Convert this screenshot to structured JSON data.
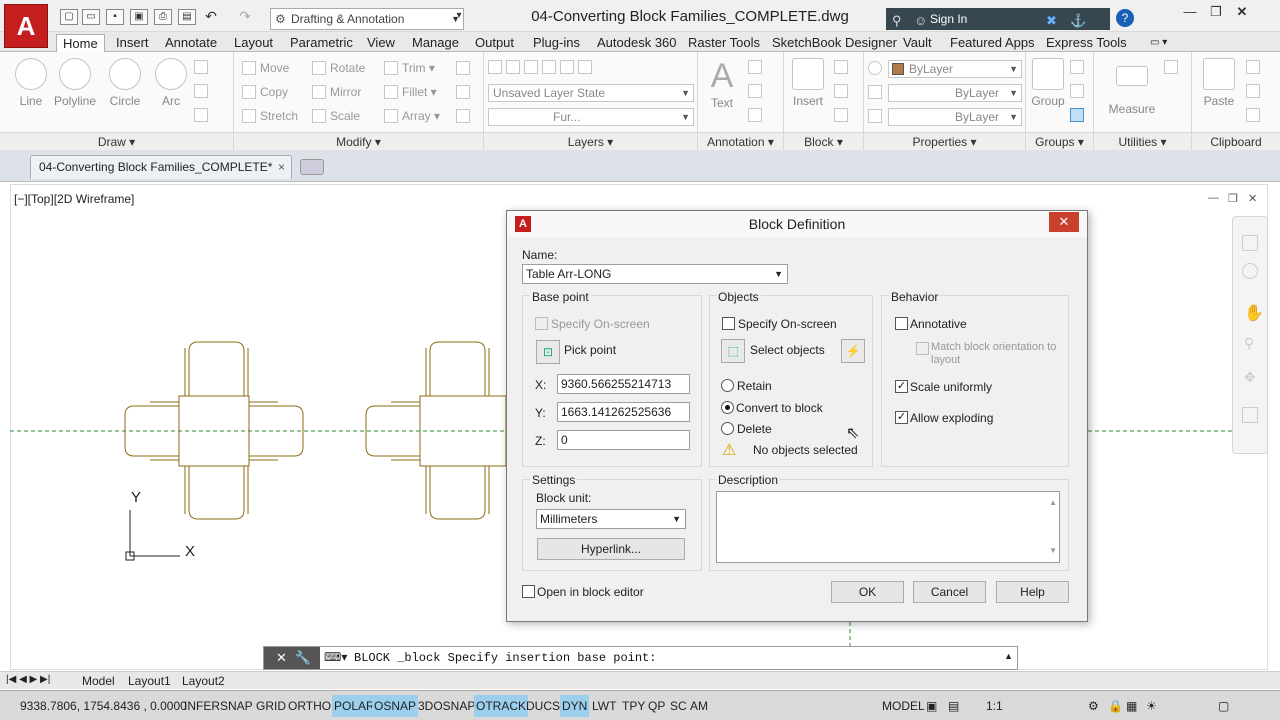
{
  "app": {
    "logo_letter": "A",
    "workspace": "Drafting & Annotation",
    "document_title": "04-Converting Block Families_COMPLETE.dwg",
    "signin": "Sign In"
  },
  "ribbon": {
    "tabs": [
      "Home",
      "Insert",
      "Annotate",
      "Layout",
      "Parametric",
      "View",
      "Manage",
      "Output",
      "Plug-ins",
      "Autodesk 360",
      "Raster Tools",
      "SketchBook Designer",
      "Vault",
      "Featured Apps",
      "Express Tools"
    ],
    "draw": {
      "line": "Line",
      "polyline": "Polyline",
      "circle": "Circle",
      "arc": "Arc",
      "title": "Draw"
    },
    "modify": {
      "move": "Move",
      "rotate": "Rotate",
      "trim": "Trim",
      "copy": "Copy",
      "mirror": "Mirror",
      "fillet": "Fillet",
      "stretch": "Stretch",
      "scale": "Scale",
      "array": "Array",
      "title": "Modify"
    },
    "layers": {
      "state": "Unsaved Layer State",
      "current": "Fur...",
      "title": "Layers"
    },
    "annotation": {
      "text": "Text",
      "title": "Annotation"
    },
    "block": {
      "insert": "Insert",
      "title": "Block"
    },
    "properties": {
      "color": "ByLayer",
      "linetype": "ByLayer",
      "lineweight": "ByLayer",
      "title": "Properties",
      "swatch": "#b07a4a"
    },
    "groups": {
      "group": "Group",
      "title": "Groups"
    },
    "utilities": {
      "measure": "Measure",
      "title": "Utilities"
    },
    "clipboard": {
      "paste": "Paste",
      "title": "Clipboard"
    }
  },
  "doc_tab": {
    "label": "04-Converting Block Families_COMPLETE*",
    "close": "×"
  },
  "viewport": {
    "label": "[−][Top][2D Wireframe]",
    "ucs_y": "Y",
    "ucs_x": "X",
    "furniture_color": "#8b6d14",
    "centerline_color": "#2e8b2e"
  },
  "dialog": {
    "title": "Block Definition",
    "close": "✕",
    "name_label": "Name:",
    "name_value": "Table Arr-LONG",
    "base_point": {
      "title": "Base point",
      "specify": "Specify On-screen",
      "pick": "Pick point",
      "x_label": "X:",
      "x": "9360.566255214713",
      "y_label": "Y:",
      "y": "1663.141262525636",
      "z_label": "Z:",
      "z": "0"
    },
    "objects": {
      "title": "Objects",
      "specify": "Specify On-screen",
      "select": "Select objects",
      "retain": "Retain",
      "convert": "Convert to block",
      "delete": "Delete",
      "warning": "No objects selected"
    },
    "behavior": {
      "title": "Behavior",
      "annotative": "Annotative",
      "match": "Match block orientation to layout",
      "scale": "Scale uniformly",
      "exploding": "Allow exploding"
    },
    "settings": {
      "title": "Settings",
      "unit_label": "Block unit:",
      "unit": "Millimeters",
      "hyperlink": "Hyperlink..."
    },
    "description": {
      "title": "Description"
    },
    "open_editor": "Open in block editor",
    "ok": "OK",
    "cancel": "Cancel",
    "help": "Help"
  },
  "command": {
    "prompt": "BLOCK _block Specify insertion base point:"
  },
  "layout_tabs": [
    "Model",
    "Layout1",
    "Layout2"
  ],
  "status": {
    "coords": "9338.7806, 1754.8436 , 0.0000",
    "toggles": [
      {
        "label": "INFER",
        "on": false
      },
      {
        "label": "SNAP",
        "on": false
      },
      {
        "label": "GRID",
        "on": false
      },
      {
        "label": "ORTHO",
        "on": false
      },
      {
        "label": "POLAR",
        "on": true
      },
      {
        "label": "OSNAP",
        "on": true
      },
      {
        "label": "3DOSNAP",
        "on": false
      },
      {
        "label": "OTRACK",
        "on": true
      },
      {
        "label": "DUCS",
        "on": false
      },
      {
        "label": "DYN",
        "on": true
      },
      {
        "label": "LWT",
        "on": false
      },
      {
        "label": "TPY",
        "on": false
      },
      {
        "label": "QP",
        "on": false
      },
      {
        "label": "SC",
        "on": false
      },
      {
        "label": "AM",
        "on": false
      }
    ],
    "model": "MODEL",
    "scale": "1:1"
  }
}
